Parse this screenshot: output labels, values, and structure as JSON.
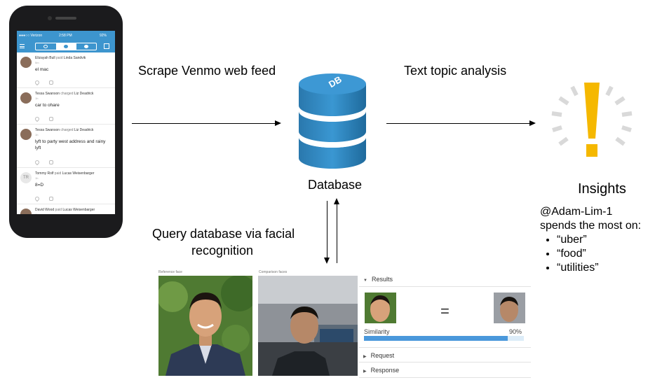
{
  "phone": {
    "status": {
      "carrier": "●●●○○ Verizon",
      "time": "2:58 PM",
      "battery": "92%"
    },
    "feed": [
      {
        "name": "Elizayah Bull",
        "action": "paid",
        "target": "Linda Sandvik",
        "time": "5m",
        "message": "el mac",
        "avatar": "photo"
      },
      {
        "name": "Tessa Swanson",
        "action": "charged",
        "target": "Liz Deadrick",
        "time": "1h",
        "message": "car to ohare",
        "avatar": "photo"
      },
      {
        "name": "Tessa Swanson",
        "action": "charged",
        "target": "Liz Deadrick",
        "time": "1h",
        "message": "lyft to party west address and rainy lyft",
        "avatar": "photo"
      },
      {
        "name": "Tommy Rolf",
        "action": "paid",
        "target": "Lucas Weisenbarger",
        "time": "1h",
        "message": "8=D",
        "avatar": "TR"
      },
      {
        "name": "David Wood",
        "action": "paid",
        "target": "Lucas Weisenbarger",
        "time": "1h",
        "message": "",
        "avatar": "photo"
      }
    ]
  },
  "labels": {
    "scrape": "Scrape Venmo web feed",
    "database_icon": "DB",
    "database": "Database",
    "topic": "Text topic analysis",
    "query_line1": "Query database via facial",
    "query_line2": "recognition"
  },
  "insights": {
    "title": "Insights",
    "line1": "@Adam-Lim-1",
    "line2": "spends the most on:",
    "items": [
      "“uber”",
      "“food”",
      "“utilities”"
    ]
  },
  "face_panel": {
    "reference_caption": "Reference face",
    "comparison_caption": "Comparison faces",
    "results_label": "Results",
    "equals": "=",
    "similarity_label": "Similarity",
    "similarity_value": "90%",
    "similarity_fraction": 0.9,
    "request_label": "Request",
    "response_label": "Response"
  },
  "colors": {
    "venmo_blue": "#3d95ce",
    "db_blue": "#2f86c0",
    "exclamation_yellow": "#f5b800",
    "similarity_bar": "#4a98db"
  },
  "icons": {
    "database": "database-cylinder-icon",
    "insight": "exclamation-burst-icon"
  }
}
